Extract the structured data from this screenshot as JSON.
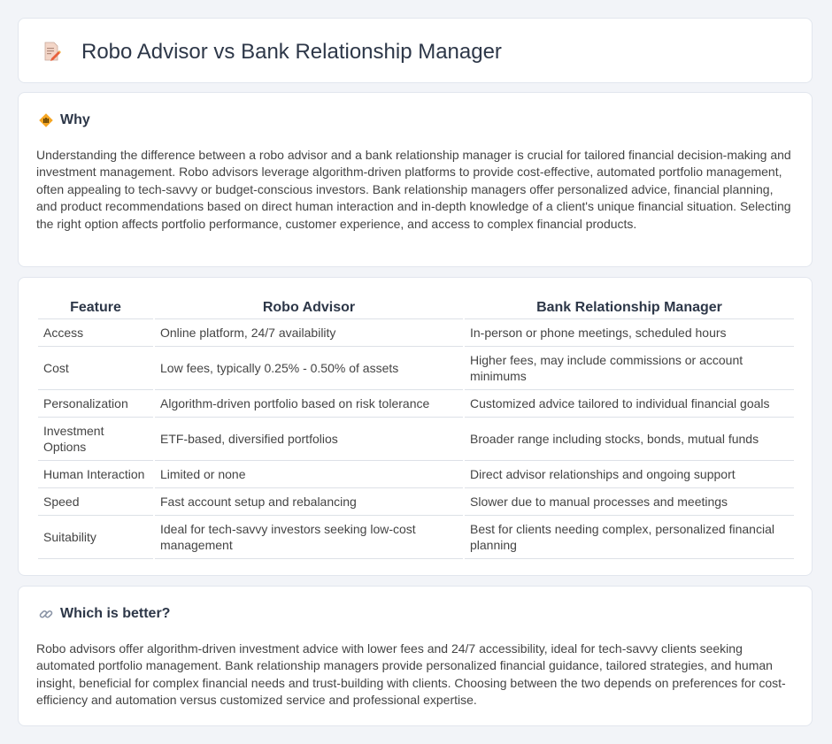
{
  "header": {
    "title": "Robo Advisor vs Bank Relationship Manager",
    "icon": "document-pencil-icon"
  },
  "why": {
    "heading": "Why",
    "icon": "diamond-sign-icon",
    "text": "Understanding the difference between a robo advisor and a bank relationship manager is crucial for tailored financial decision-making and investment management. Robo advisors leverage algorithm-driven platforms to provide cost-effective, automated portfolio management, often appealing to tech-savvy or budget-conscious investors. Bank relationship managers offer personalized advice, financial planning, and product recommendations based on direct human interaction and in-depth knowledge of a client's unique financial situation. Selecting the right option affects portfolio performance, customer experience, and access to complex financial products."
  },
  "table": {
    "headers": [
      "Feature",
      "Robo Advisor",
      "Bank Relationship Manager"
    ],
    "rows": [
      [
        "Access",
        "Online platform, 24/7 availability",
        "In-person or phone meetings, scheduled hours"
      ],
      [
        "Cost",
        "Low fees, typically 0.25% - 0.50% of assets",
        "Higher fees, may include commissions or account minimums"
      ],
      [
        "Personalization",
        "Algorithm-driven portfolio based on risk tolerance",
        "Customized advice tailored to individual financial goals"
      ],
      [
        "Investment Options",
        "ETF-based, diversified portfolios",
        "Broader range including stocks, bonds, mutual funds"
      ],
      [
        "Human Interaction",
        "Limited or none",
        "Direct advisor relationships and ongoing support"
      ],
      [
        "Speed",
        "Fast account setup and rebalancing",
        "Slower due to manual processes and meetings"
      ],
      [
        "Suitability",
        "Ideal for tech-savvy investors seeking low-cost management",
        "Best for clients needing complex, personalized financial planning"
      ]
    ]
  },
  "better": {
    "heading": "Which is better?",
    "icon": "link-icon",
    "text": "Robo advisors offer algorithm-driven investment advice with lower fees and 24/7 accessibility, ideal for tech-savvy clients seeking automated portfolio management. Bank relationship managers provide personalized financial guidance, tailored strategies, and human insight, beneficial for complex financial needs and trust-building with clients. Choosing between the two depends on preferences for cost-efficiency and automation versus customized service and professional expertise."
  }
}
